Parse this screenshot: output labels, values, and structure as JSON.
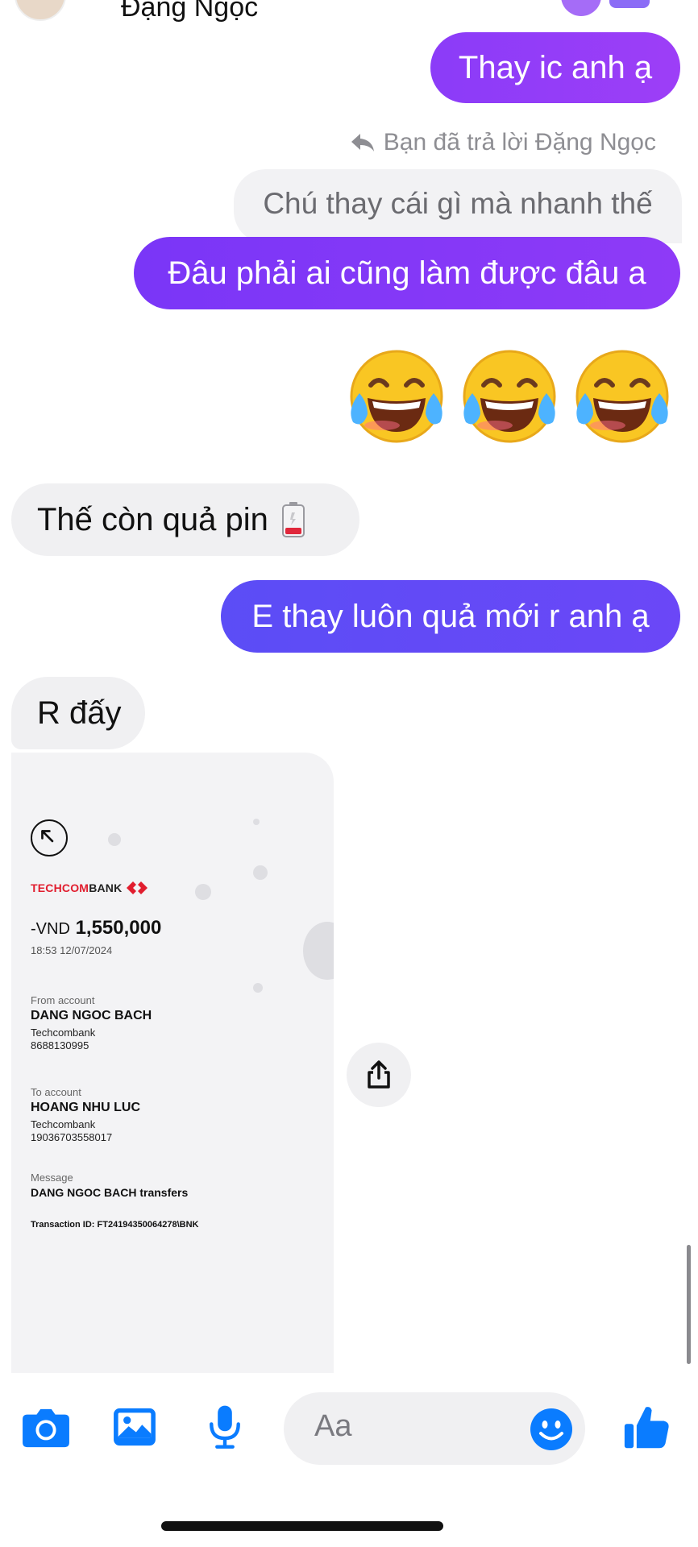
{
  "header": {
    "contact_name": "Đặng Ngọc"
  },
  "messages": {
    "m1": "Thay ic anh ạ",
    "reply_meta": "Bạn đã trả lời Đặng Ngọc",
    "quoted": "Chú thay cái gì mà nhanh thế",
    "m2": "Đâu phải ai cũng làm được đâu a",
    "m3": "Thế còn quả pin",
    "m4": "E thay luôn quả mới r anh ạ",
    "m5": "R đấy"
  },
  "receipt": {
    "bank_red": "TECHCOM",
    "bank_dark": "BANK",
    "amount_prefix": "-VND",
    "amount": "1,550,000",
    "datetime": "18:53 12/07/2024",
    "from_label": "From account",
    "from_name": "DANG NGOC BACH",
    "from_bank": "Techcombank",
    "from_number": "8688130995",
    "to_label": "To account",
    "to_name": "HOANG NHU LUC",
    "to_bank": "Techcombank",
    "to_number": "19036703558017",
    "message_label": "Message",
    "message_text": "DANG NGOC BACH transfers",
    "transaction_id": "Transaction ID: FT24194350064278\\BNK"
  },
  "composer": {
    "placeholder": "Aa"
  },
  "colors": {
    "outgoing_top": "#9333ea",
    "outgoing_bottom": "#5b4df6",
    "incoming": "#f0f0f2",
    "icon_blue": "#0a7cff",
    "techcom_red": "#e11d2e"
  },
  "icons": [
    "camera-icon",
    "image-icon",
    "microphone-icon",
    "emoji-icon",
    "thumbs-up-icon",
    "share-icon",
    "reply-icon",
    "back-arrow-icon"
  ]
}
